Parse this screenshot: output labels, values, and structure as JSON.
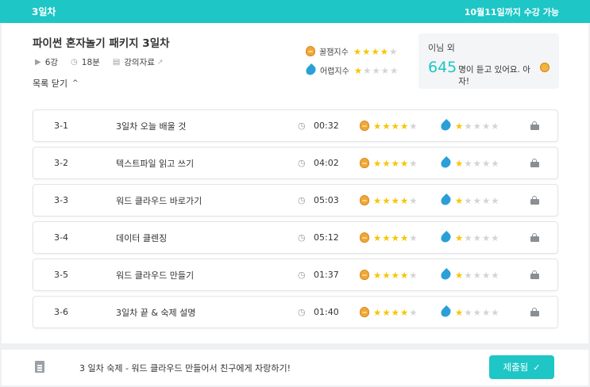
{
  "topbar": {
    "day": "3일차",
    "deadline": "10월11일까지 수강 가능"
  },
  "course": {
    "title": "파이썬 혼자놀기 패키지 3일차",
    "lectures": "6강",
    "duration": "18분",
    "materials": "강의자료",
    "toggle": "목록 닫기"
  },
  "difficulty": {
    "fun_label": "꿀잼지수",
    "fun_stars": 4,
    "hard_label": "어렵지수",
    "hard_stars": 1
  },
  "students": {
    "who": "이님 외",
    "count": "645",
    "text": "명이 듣고 있어요. 아자!"
  },
  "lessons": [
    {
      "no": "3-1",
      "name": "3일차 오늘 배울 것",
      "time": "00:32",
      "fun": 4,
      "hard": 1
    },
    {
      "no": "3-2",
      "name": "텍스트파일 읽고 쓰기",
      "time": "04:02",
      "fun": 4,
      "hard": 1
    },
    {
      "no": "3-3",
      "name": "워드 클라우드 바로가기",
      "time": "05:03",
      "fun": 4,
      "hard": 1
    },
    {
      "no": "3-4",
      "name": "데이터 클렌징",
      "time": "05:12",
      "fun": 4,
      "hard": 1
    },
    {
      "no": "3-5",
      "name": "워드 클라우드 만들기",
      "time": "01:37",
      "fun": 4,
      "hard": 1
    },
    {
      "no": "3-6",
      "name": "3일차 끝 & 숙제 설명",
      "time": "01:40",
      "fun": 4,
      "hard": 1
    }
  ],
  "homework": {
    "text": "3 일차 숙제 - 워드 클라우드 만들어서 친구에게 자랑하기!",
    "button": "제출됨"
  },
  "colors": {
    "accent": "#1ec6c6",
    "star": "#f7c600",
    "drop": "#2a9fd8"
  }
}
